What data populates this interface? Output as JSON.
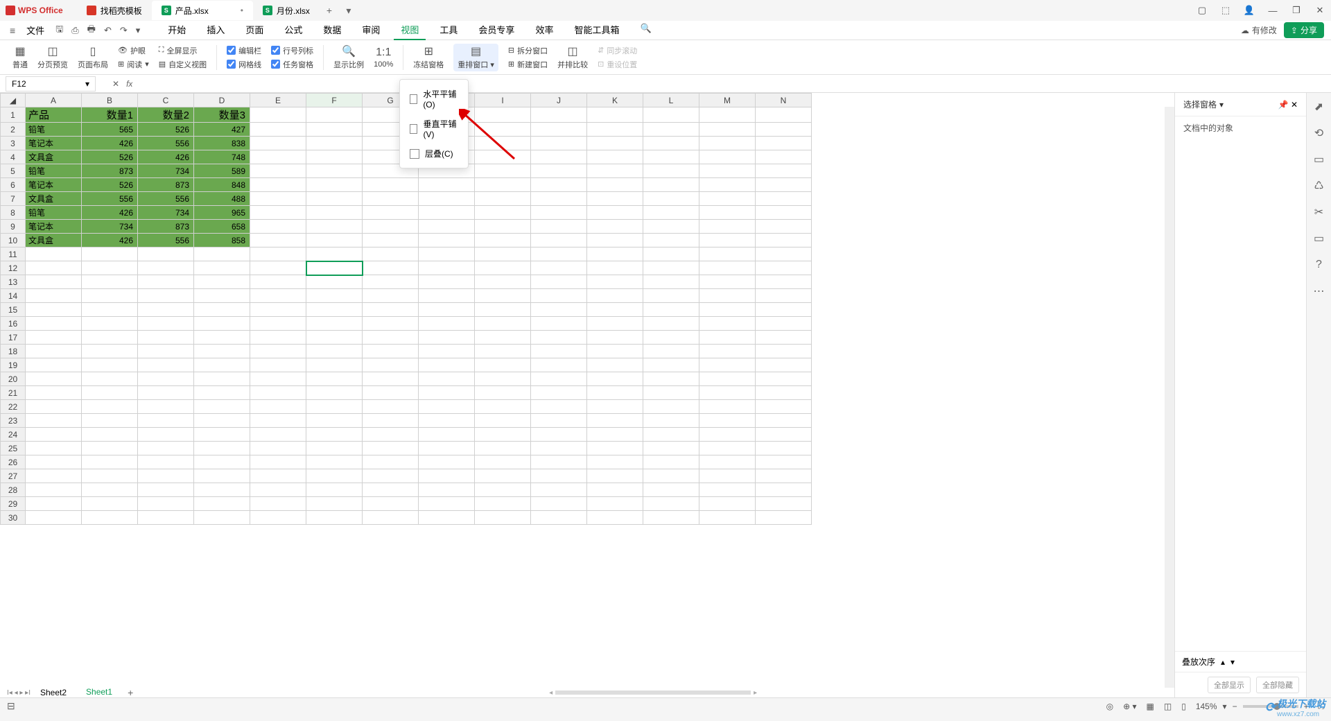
{
  "app_name": "WPS Office",
  "tabs": [
    {
      "label": "找稻壳模板",
      "icon": "d"
    },
    {
      "label": "产品.xlsx",
      "icon": "s",
      "active": true,
      "modified": "•"
    },
    {
      "label": "月份.xlsx",
      "icon": "s"
    }
  ],
  "menu": {
    "file": "文件",
    "items": [
      "开始",
      "插入",
      "页面",
      "公式",
      "数据",
      "审阅",
      "视图",
      "工具",
      "会员专享",
      "效率",
      "智能工具箱"
    ],
    "active": "视图",
    "modify": "有修改",
    "share": "分享"
  },
  "ribbon": {
    "view_modes": [
      "普通",
      "分页预览",
      "页面布局"
    ],
    "protect": "护眼",
    "fullscreen": "全屏显示",
    "read": "阅读",
    "custom_view": "自定义视图",
    "checks": [
      {
        "label": "编辑栏",
        "checked": true
      },
      {
        "label": "行号列标",
        "checked": true
      },
      {
        "label": "网格线",
        "checked": true
      },
      {
        "label": "任务窗格",
        "checked": true
      }
    ],
    "zoom": "显示比例",
    "pct": "100%",
    "freeze": "冻结窗格",
    "arrange": "重排窗口",
    "split": "拆分窗口",
    "new_window": "新建窗口",
    "side_by_side": "并排比较",
    "sync": "同步滚动",
    "reset": "重设位置"
  },
  "dropdown": {
    "items": [
      {
        "label": "水平平铺(O)"
      },
      {
        "label": "垂直平铺(V)"
      },
      {
        "label": "层叠(C)"
      }
    ]
  },
  "namebox": "F12",
  "fx": "fx",
  "columns": [
    "A",
    "B",
    "C",
    "D",
    "E",
    "F",
    "G",
    "H",
    "I",
    "J",
    "K",
    "L",
    "M",
    "N"
  ],
  "rows": 30,
  "table": {
    "header": [
      "产品",
      "数量1",
      "数量2",
      "数量3"
    ],
    "data": [
      [
        "铅笔",
        "565",
        "526",
        "427"
      ],
      [
        "笔记本",
        "426",
        "556",
        "838"
      ],
      [
        "文具盒",
        "526",
        "426",
        "748"
      ],
      [
        "铅笔",
        "873",
        "734",
        "589"
      ],
      [
        "笔记本",
        "526",
        "873",
        "848"
      ],
      [
        "文具盒",
        "556",
        "556",
        "488"
      ],
      [
        "铅笔",
        "426",
        "734",
        "965"
      ],
      [
        "笔记本",
        "734",
        "873",
        "658"
      ],
      [
        "文具盒",
        "426",
        "556",
        "858"
      ]
    ]
  },
  "right_panel": {
    "title": "选择窗格",
    "subtitle": "文档中的对象",
    "order": "叠放次序",
    "show_all": "全部显示",
    "hide_all": "全部隐藏"
  },
  "sheets": {
    "list": [
      "Sheet2",
      "Sheet1"
    ],
    "active": "Sheet1"
  },
  "status": {
    "zoom": "145%"
  },
  "watermark": {
    "main": "极光下载站",
    "sub": "www.xz7.com"
  }
}
